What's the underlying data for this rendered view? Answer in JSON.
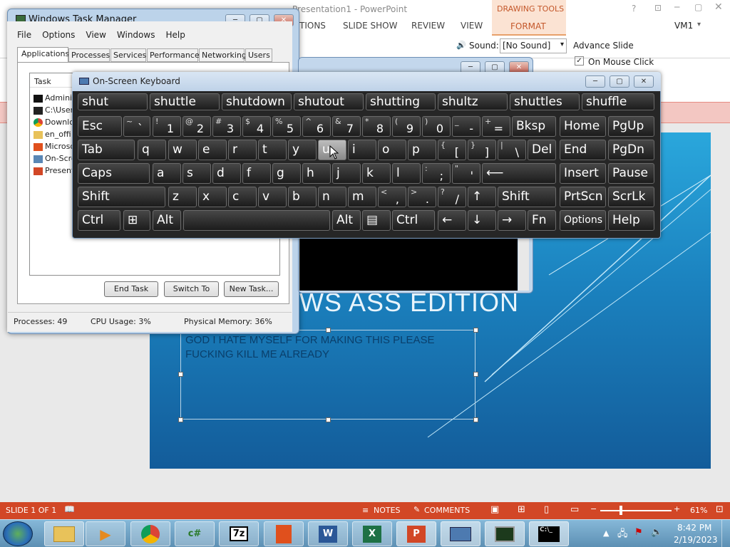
{
  "powerpoint": {
    "title": "Presentation1 - PowerPoint",
    "ribbon_tabs": [
      "TIONS",
      "SLIDE SHOW",
      "REVIEW",
      "VIEW"
    ],
    "drawing_tools": "DRAWING TOOLS",
    "format_tab": "FORMAT",
    "user": "VM1",
    "sound_label": "Sound:",
    "sound_value": "[No Sound]",
    "advance_slide": "Advance Slide",
    "on_mouse_click": "On Mouse Click",
    "slide_title": "WS ASS EDITION",
    "slide_body": "GOD I HATE MYSELF FOR MAKING THIS PLEASE FUCKING KILL ME ALREADY",
    "status": {
      "slide": "SLIDE 1 OF 1",
      "notes": "NOTES",
      "comments": "COMMENTS",
      "zoom": "61%"
    }
  },
  "taskmanager": {
    "title": "Windows Task Manager",
    "menu": [
      "File",
      "Options",
      "View",
      "Windows",
      "Help"
    ],
    "tabs": [
      "Applications",
      "Processes",
      "Services",
      "Performance",
      "Networking",
      "Users"
    ],
    "column": "Task",
    "tasks": [
      "Adminis",
      "C:\\User",
      "Downlo",
      "en_offi",
      "Microso",
      "On-Scre",
      "Present"
    ],
    "buttons": {
      "end": "End Task",
      "switch": "Switch To",
      "new": "New Task..."
    },
    "status": {
      "processes": "Processes: 49",
      "cpu": "CPU Usage: 3%",
      "memory": "Physical Memory: 36%"
    }
  },
  "osk": {
    "title": "On-Screen Keyboard",
    "predictions": [
      "shut",
      "shuttle",
      "shutdown",
      "shutout",
      "shutting",
      "shultz",
      "shuttles",
      "shuffle"
    ],
    "row1": [
      "Esc",
      "~ `",
      "! 1",
      "@ 2",
      "# 3",
      "$ 4",
      "% 5",
      "^ 6",
      "& 7",
      "* 8",
      "( 9",
      ") 0",
      "_ -",
      "+ =",
      "Bksp",
      "Home",
      "PgUp"
    ],
    "row2": [
      "Tab",
      "q",
      "w",
      "e",
      "r",
      "t",
      "y",
      "u",
      "i",
      "o",
      "p",
      "{ [",
      "} ]",
      "| \\",
      "Del",
      "End",
      "PgDn"
    ],
    "row3": [
      "Caps",
      "a",
      "s",
      "d",
      "f",
      "g",
      "h",
      "j",
      "k",
      "l",
      ": ;",
      "\" '",
      "⟵",
      "Insert",
      "Pause"
    ],
    "row4": [
      "Shift",
      "z",
      "x",
      "c",
      "v",
      "b",
      "n",
      "m",
      "< ,",
      "> .",
      "? /",
      "↑",
      "Shift",
      "PrtScn",
      "ScrLk"
    ],
    "row5": [
      "Ctrl",
      "⊞",
      "Alt",
      "",
      "Alt",
      "▤",
      "Ctrl",
      "←",
      "↓",
      "→",
      "Fn",
      "Options",
      "Help"
    ]
  },
  "taskbar": {
    "clock_time": "8:42 PM",
    "clock_date": "2/19/2023",
    "apps": [
      "explorer",
      "media",
      "chrome",
      "c#",
      "7z",
      "office",
      "word",
      "excel",
      "powerpoint",
      "osk",
      "taskmgr",
      "cmd"
    ]
  },
  "colors": {
    "pp_accent": "#d24726",
    "slide_blue": "#1b82bf",
    "osk_key": "#2a2a2a"
  }
}
